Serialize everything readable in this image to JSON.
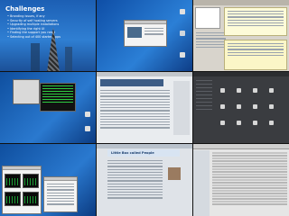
{
  "slide": {
    "title": "Challenges",
    "bullets": [
      "Branding issues, if any",
      "Security of self hosting servers",
      "Upgrading multiple installations",
      "Identifying the right UI",
      "Finding the support you need",
      "Selecting out of 400 starter apps"
    ]
  },
  "blog": {
    "title": "Little Box called People"
  },
  "colors": {
    "desktop_blue": "#2f7fd3",
    "terminal_green": "#2ecc40",
    "dark_panel": "#3a3c40"
  }
}
